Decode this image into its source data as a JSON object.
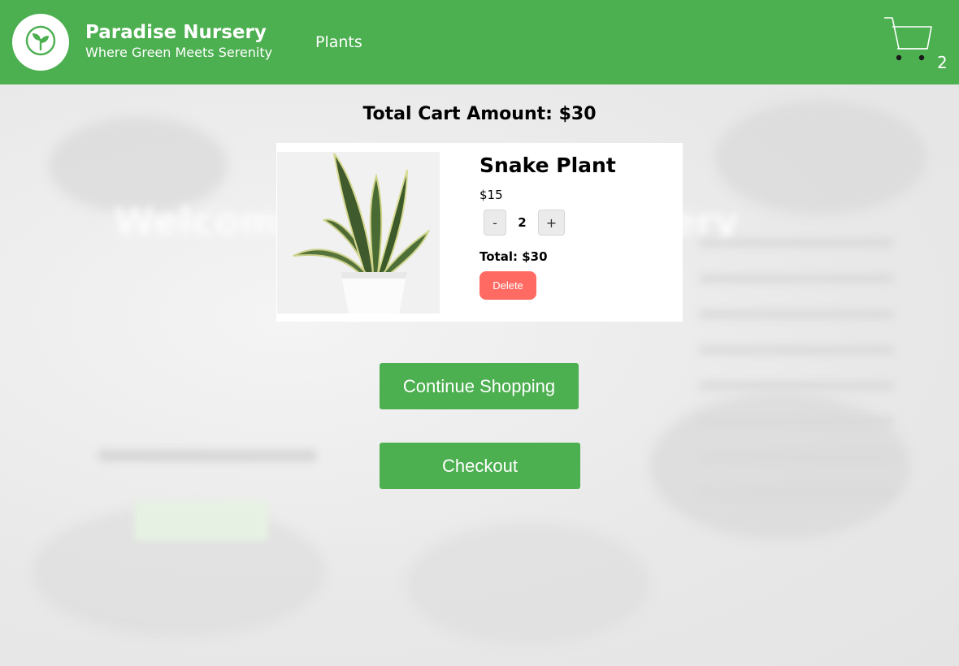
{
  "header": {
    "brand_title": "Paradise Nursery",
    "brand_tagline": "Where Green Meets Serenity",
    "nav_link": "Plants",
    "cart_count": "2",
    "logo_icon": "sprout-icon",
    "cart_icon": "shopping-cart-icon"
  },
  "background": {
    "heading": "Welcome To Paradise Nursery"
  },
  "cart": {
    "total_label": "Total Cart Amount: $30",
    "items": [
      {
        "name": "Snake Plant",
        "price": "$15",
        "decrement_label": "-",
        "quantity": "2",
        "increment_label": "+",
        "total": "Total: $30",
        "delete_label": "Delete",
        "image": "snake-plant-image"
      }
    ],
    "continue_label": "Continue Shopping",
    "checkout_label": "Checkout"
  },
  "colors": {
    "brand_green": "#4caf50",
    "delete_red": "#ff6b63",
    "background_gray": "#ececec"
  }
}
